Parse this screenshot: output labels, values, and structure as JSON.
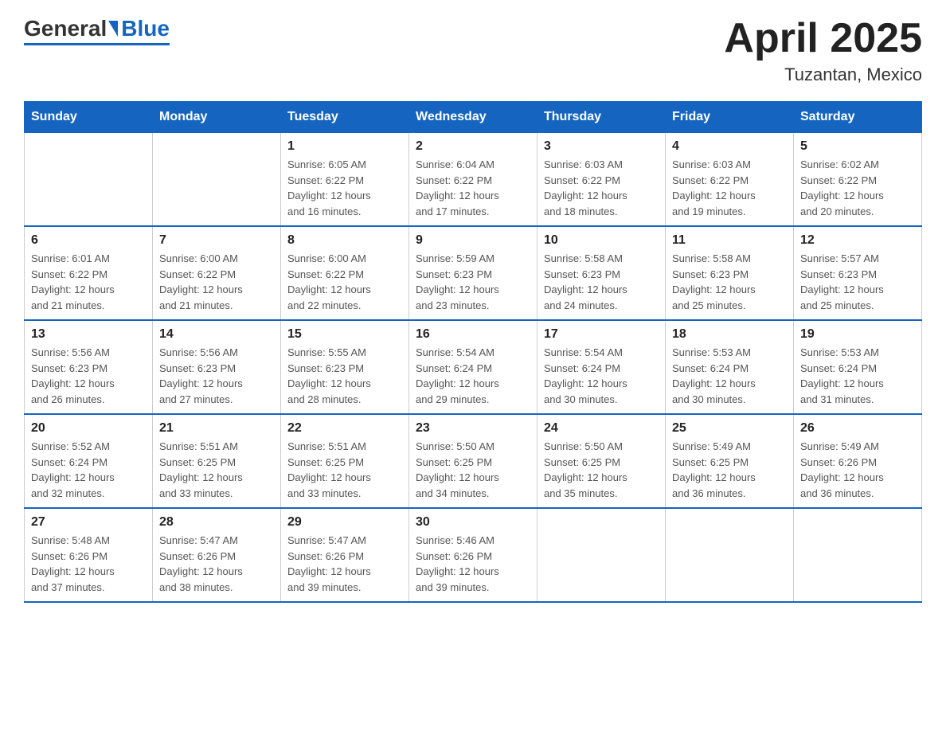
{
  "header": {
    "logo_general": "General",
    "logo_blue": "Blue",
    "title": "April 2025",
    "subtitle": "Tuzantan, Mexico"
  },
  "days_of_week": [
    "Sunday",
    "Monday",
    "Tuesday",
    "Wednesday",
    "Thursday",
    "Friday",
    "Saturday"
  ],
  "weeks": [
    [
      {
        "day": "",
        "info": ""
      },
      {
        "day": "",
        "info": ""
      },
      {
        "day": "1",
        "info": "Sunrise: 6:05 AM\nSunset: 6:22 PM\nDaylight: 12 hours\nand 16 minutes."
      },
      {
        "day": "2",
        "info": "Sunrise: 6:04 AM\nSunset: 6:22 PM\nDaylight: 12 hours\nand 17 minutes."
      },
      {
        "day": "3",
        "info": "Sunrise: 6:03 AM\nSunset: 6:22 PM\nDaylight: 12 hours\nand 18 minutes."
      },
      {
        "day": "4",
        "info": "Sunrise: 6:03 AM\nSunset: 6:22 PM\nDaylight: 12 hours\nand 19 minutes."
      },
      {
        "day": "5",
        "info": "Sunrise: 6:02 AM\nSunset: 6:22 PM\nDaylight: 12 hours\nand 20 minutes."
      }
    ],
    [
      {
        "day": "6",
        "info": "Sunrise: 6:01 AM\nSunset: 6:22 PM\nDaylight: 12 hours\nand 21 minutes."
      },
      {
        "day": "7",
        "info": "Sunrise: 6:00 AM\nSunset: 6:22 PM\nDaylight: 12 hours\nand 21 minutes."
      },
      {
        "day": "8",
        "info": "Sunrise: 6:00 AM\nSunset: 6:22 PM\nDaylight: 12 hours\nand 22 minutes."
      },
      {
        "day": "9",
        "info": "Sunrise: 5:59 AM\nSunset: 6:23 PM\nDaylight: 12 hours\nand 23 minutes."
      },
      {
        "day": "10",
        "info": "Sunrise: 5:58 AM\nSunset: 6:23 PM\nDaylight: 12 hours\nand 24 minutes."
      },
      {
        "day": "11",
        "info": "Sunrise: 5:58 AM\nSunset: 6:23 PM\nDaylight: 12 hours\nand 25 minutes."
      },
      {
        "day": "12",
        "info": "Sunrise: 5:57 AM\nSunset: 6:23 PM\nDaylight: 12 hours\nand 25 minutes."
      }
    ],
    [
      {
        "day": "13",
        "info": "Sunrise: 5:56 AM\nSunset: 6:23 PM\nDaylight: 12 hours\nand 26 minutes."
      },
      {
        "day": "14",
        "info": "Sunrise: 5:56 AM\nSunset: 6:23 PM\nDaylight: 12 hours\nand 27 minutes."
      },
      {
        "day": "15",
        "info": "Sunrise: 5:55 AM\nSunset: 6:23 PM\nDaylight: 12 hours\nand 28 minutes."
      },
      {
        "day": "16",
        "info": "Sunrise: 5:54 AM\nSunset: 6:24 PM\nDaylight: 12 hours\nand 29 minutes."
      },
      {
        "day": "17",
        "info": "Sunrise: 5:54 AM\nSunset: 6:24 PM\nDaylight: 12 hours\nand 30 minutes."
      },
      {
        "day": "18",
        "info": "Sunrise: 5:53 AM\nSunset: 6:24 PM\nDaylight: 12 hours\nand 30 minutes."
      },
      {
        "day": "19",
        "info": "Sunrise: 5:53 AM\nSunset: 6:24 PM\nDaylight: 12 hours\nand 31 minutes."
      }
    ],
    [
      {
        "day": "20",
        "info": "Sunrise: 5:52 AM\nSunset: 6:24 PM\nDaylight: 12 hours\nand 32 minutes."
      },
      {
        "day": "21",
        "info": "Sunrise: 5:51 AM\nSunset: 6:25 PM\nDaylight: 12 hours\nand 33 minutes."
      },
      {
        "day": "22",
        "info": "Sunrise: 5:51 AM\nSunset: 6:25 PM\nDaylight: 12 hours\nand 33 minutes."
      },
      {
        "day": "23",
        "info": "Sunrise: 5:50 AM\nSunset: 6:25 PM\nDaylight: 12 hours\nand 34 minutes."
      },
      {
        "day": "24",
        "info": "Sunrise: 5:50 AM\nSunset: 6:25 PM\nDaylight: 12 hours\nand 35 minutes."
      },
      {
        "day": "25",
        "info": "Sunrise: 5:49 AM\nSunset: 6:25 PM\nDaylight: 12 hours\nand 36 minutes."
      },
      {
        "day": "26",
        "info": "Sunrise: 5:49 AM\nSunset: 6:26 PM\nDaylight: 12 hours\nand 36 minutes."
      }
    ],
    [
      {
        "day": "27",
        "info": "Sunrise: 5:48 AM\nSunset: 6:26 PM\nDaylight: 12 hours\nand 37 minutes."
      },
      {
        "day": "28",
        "info": "Sunrise: 5:47 AM\nSunset: 6:26 PM\nDaylight: 12 hours\nand 38 minutes."
      },
      {
        "day": "29",
        "info": "Sunrise: 5:47 AM\nSunset: 6:26 PM\nDaylight: 12 hours\nand 39 minutes."
      },
      {
        "day": "30",
        "info": "Sunrise: 5:46 AM\nSunset: 6:26 PM\nDaylight: 12 hours\nand 39 minutes."
      },
      {
        "day": "",
        "info": ""
      },
      {
        "day": "",
        "info": ""
      },
      {
        "day": "",
        "info": ""
      }
    ]
  ]
}
